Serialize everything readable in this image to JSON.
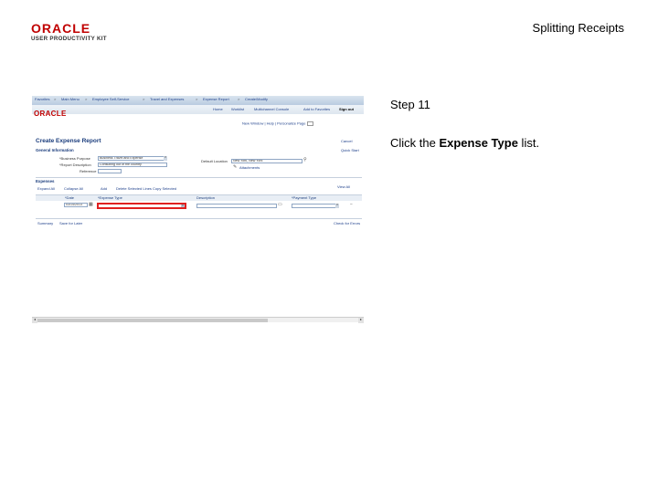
{
  "slide": {
    "logo_main": "ORACLE",
    "logo_sub": "USER PRODUCTIVITY KIT",
    "title": "Splitting Receipts",
    "step": "Step 11",
    "instruction_prefix": "Click the ",
    "instruction_bold": "Expense Type",
    "instruction_suffix": " list."
  },
  "screenshot": {
    "breadcrumbs": [
      "Favorites",
      "Main Menu",
      "Employee Self-Service",
      "Travel and Expenses",
      "Expense Report",
      "Create/Modify"
    ],
    "breadcrumb_sep": ">",
    "menu": [
      "Home",
      "Worklist",
      "Multichannel Console",
      "Add to Favorites",
      "Sign out"
    ],
    "mini_logo": "ORACLE",
    "toolbar": {
      "new_window": "New Window",
      "help": "Help",
      "personalize": "Personalize Page"
    },
    "title": "Create Expense Report",
    "cancel": "Cancel",
    "header": {
      "section_label": "General Information",
      "quick_start": "Quick Start",
      "purpose_label": "*Business Purpose",
      "purpose_value": "Business Travel and Expense",
      "description_label": "*Report Description",
      "description_value": "Consulting out of the country",
      "reference_label": "Reference",
      "default_location_label": "Default Location",
      "default_location_value": "New York, New York",
      "attachments": "Attachments"
    },
    "expenses": {
      "section_label": "Expenses",
      "actions": [
        "Expand All",
        "Collapse All",
        "Add",
        "Delete Selected Lines",
        "Copy Selected"
      ],
      "view_all": "View All",
      "columns": [
        "*Date",
        "*Expense Type",
        "Description",
        "*Payment Type"
      ],
      "row_date": "03/14/2013"
    },
    "footer": {
      "summary": "Summary",
      "save": "Save for Later",
      "check": "Check for Errors"
    }
  }
}
